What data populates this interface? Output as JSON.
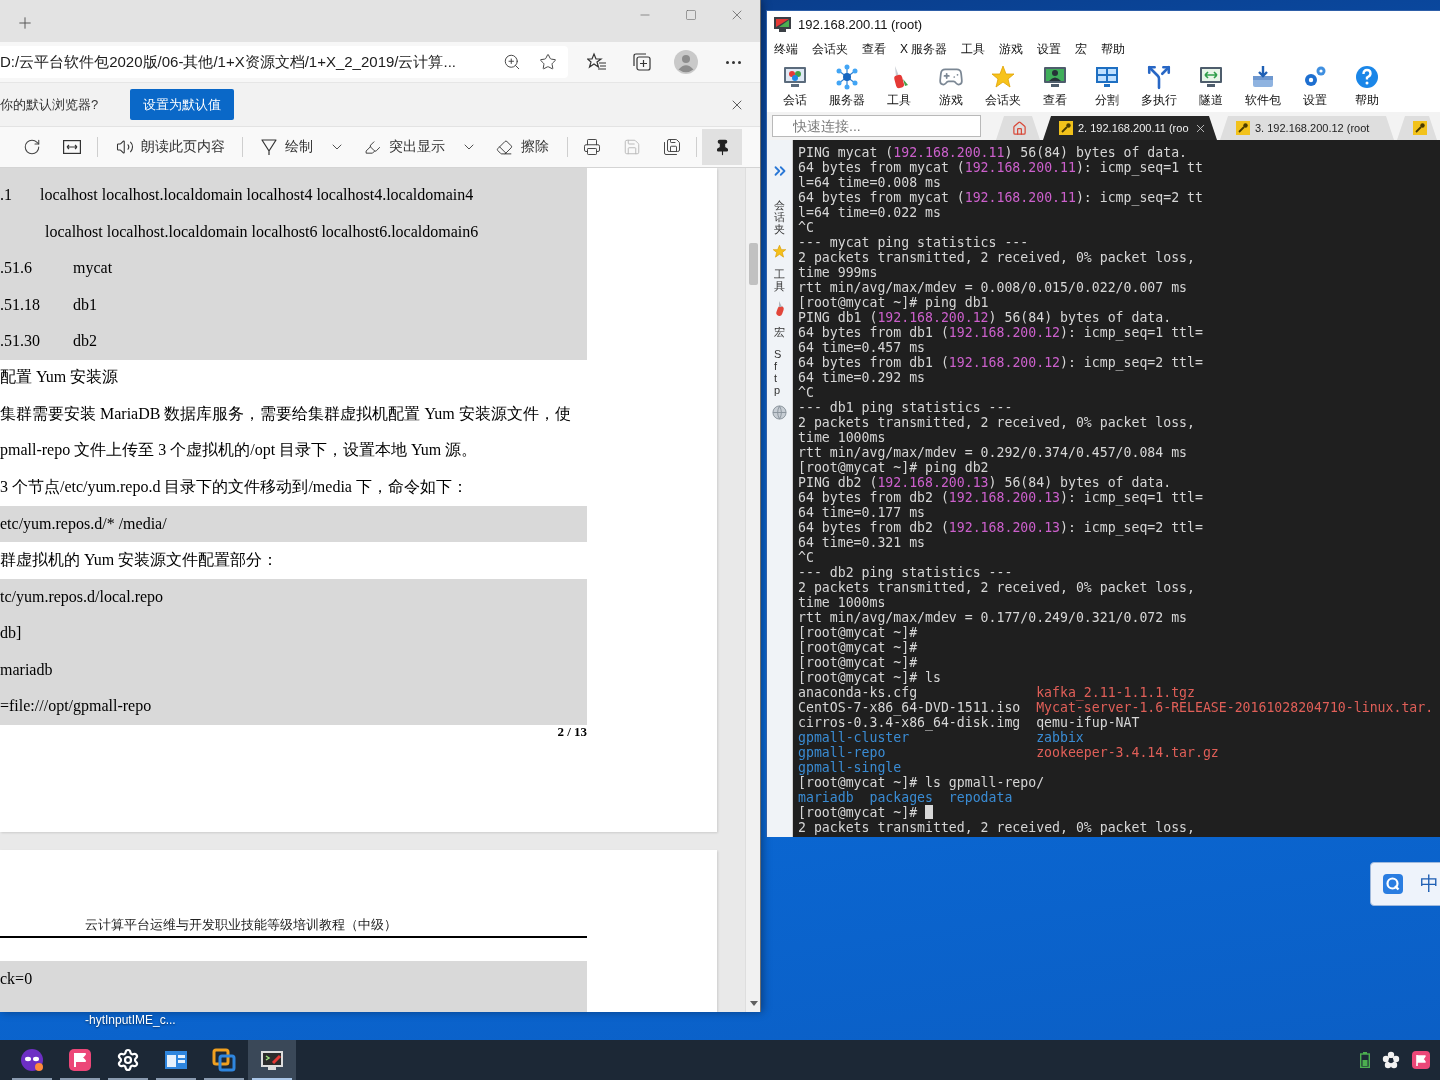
{
  "browser": {
    "address": "D:/云平台软件包2020版/06-其他/1+X资源文档/1+X_2_2019/云计算...",
    "infobar": {
      "message": "你的默认浏览器?",
      "button": "设置为默认值"
    },
    "pdf_toolbar": {
      "read_aloud": "朗读此页内容",
      "draw": "绘制",
      "highlight": "突出显示",
      "erase": "擦除",
      "save": {
        "disabled": true
      },
      "pin": {
        "on": true
      }
    },
    "pages": [
      {
        "blocks": [
          {
            "kind": "code",
            "lines": [
              {
                "address": ".1",
                "text": "localhost localhost.localdomain localhost4 localhost4.localdomain4"
              },
              {
                "text": "localhost localhost.localdomain localhost6 localhost6.localdomain6"
              },
              {
                "address": ".51.6",
                "text": "mycat"
              },
              {
                "address": ".51.18",
                "text": "db1"
              },
              {
                "address": ".51.30",
                "text": "db2"
              }
            ]
          },
          {
            "kind": "text",
            "text": "配置 Yum 安装源"
          },
          {
            "kind": "text",
            "text": "集群需要安装 MariaDB 数据库服务，需要给集群虚拟机配置 Yum 安装源文件，使"
          },
          {
            "kind": "text",
            "text": "pmall-repo 文件上传至 3 个虚拟机的/opt 目录下，设置本地 Yum 源。"
          },
          {
            "kind": "text",
            "text": "3 个节点/etc/yum.repo.d 目录下的文件移动到/media 下，命令如下："
          },
          {
            "kind": "code",
            "lines": [
              {
                "text": "etc/yum.repos.d/* /media/"
              }
            ]
          },
          {
            "kind": "text",
            "text": "群虚拟机的 Yum 安装源文件配置部分："
          },
          {
            "kind": "code",
            "lines": [
              {
                "text": "tc/yum.repos.d/local.repo"
              },
              {
                "text": "db]"
              },
              {
                "text": "mariadb"
              },
              {
                "text": "=file:///opt/gpmall-repo"
              }
            ]
          },
          {
            "kind": "page_number",
            "text": "2 / 13"
          }
        ]
      },
      {
        "blocks": [
          {
            "kind": "header",
            "text": "云计算平台运维与开发职业技能等级培训教程（中级）"
          },
          {
            "kind": "code",
            "lines": [
              {
                "text": "ck=0"
              }
            ]
          }
        ]
      }
    ]
  },
  "terminal": {
    "title": "192.168.200.11 (root)",
    "menu": [
      "终端",
      "会话夹",
      "查看",
      "X 服务器",
      "工具",
      "游戏",
      "设置",
      "宏",
      "帮助"
    ],
    "toolbar": [
      "会话",
      "服务器",
      "工具",
      "游戏",
      "会话夹",
      "查看",
      "分割",
      "多执行",
      "隧道",
      "软件包",
      "设置",
      "帮助"
    ],
    "quick_connect": {
      "placeholder": "快速连接..."
    },
    "tabs": [
      {
        "kind": "home",
        "selected": false
      },
      {
        "kind": "session",
        "label": "2. 192.168.200.11 (roo",
        "selected": true
      },
      {
        "kind": "session",
        "label": "3. 192.168.200.12 (root",
        "selected": false
      },
      {
        "kind": "session",
        "selected": false
      }
    ],
    "sidebar": {
      "tabs": [
        {
          "label": "会话夹"
        },
        {
          "label": "工具"
        },
        {
          "label": "宏"
        },
        {
          "label": "Sftp"
        }
      ]
    },
    "lines": [
      {
        "segments": [
          {
            "text": "PING mycat ("
          },
          {
            "text": "192.168.200.11",
            "kind": "ip"
          },
          {
            "text": ") 56(84) bytes of data."
          }
        ]
      },
      {
        "segments": [
          {
            "text": "64 bytes from mycat ("
          },
          {
            "text": "192.168.200.11",
            "kind": "ip"
          },
          {
            "text": "): icmp_seq=1 tt"
          }
        ]
      },
      {
        "text": "l=64 time=0.008 ms"
      },
      {
        "segments": [
          {
            "text": "64 bytes from mycat ("
          },
          {
            "text": "192.168.200.11",
            "kind": "ip"
          },
          {
            "text": "): icmp_seq=2 tt"
          }
        ]
      },
      {
        "text": "l=64 time=0.022 ms"
      },
      {
        "text": "^C"
      },
      {
        "text": "--- mycat ping statistics ---"
      },
      {
        "text": "2 packets transmitted, 2 received, 0% packet loss,"
      },
      {
        "text": "time 999ms"
      },
      {
        "text": "rtt min/avg/max/mdev = 0.008/0.015/0.022/0.007 ms"
      },
      {
        "text": "[root@mycat ~]# ping db1"
      },
      {
        "segments": [
          {
            "text": "PING db1 ("
          },
          {
            "text": "192.168.200.12",
            "kind": "ip"
          },
          {
            "text": ") 56(84) bytes of data."
          }
        ]
      },
      {
        "segments": [
          {
            "text": "64 bytes from db1 ("
          },
          {
            "text": "192.168.200.12",
            "kind": "ip"
          },
          {
            "text": "): icmp_seq=1 ttl="
          }
        ]
      },
      {
        "text": "64 time=0.457 ms"
      },
      {
        "segments": [
          {
            "text": "64 bytes from db1 ("
          },
          {
            "text": "192.168.200.12",
            "kind": "ip"
          },
          {
            "text": "): icmp_seq=2 ttl="
          }
        ]
      },
      {
        "text": "64 time=0.292 ms"
      },
      {
        "text": "^C"
      },
      {
        "text": "--- db1 ping statistics ---"
      },
      {
        "text": "2 packets transmitted, 2 received, 0% packet loss,"
      },
      {
        "text": "time 1000ms"
      },
      {
        "text": "rtt min/avg/max/mdev = 0.292/0.374/0.457/0.084 ms"
      },
      {
        "text": "[root@mycat ~]# ping db2"
      },
      {
        "segments": [
          {
            "text": "PING db2 ("
          },
          {
            "text": "192.168.200.13",
            "kind": "ip"
          },
          {
            "text": ") 56(84) bytes of data."
          }
        ]
      },
      {
        "segments": [
          {
            "text": "64 bytes from db2 ("
          },
          {
            "text": "192.168.200.13",
            "kind": "ip"
          },
          {
            "text": "): icmp_seq=1 ttl="
          }
        ]
      },
      {
        "text": "64 time=0.177 ms"
      },
      {
        "segments": [
          {
            "text": "64 bytes from db2 ("
          },
          {
            "text": "192.168.200.13",
            "kind": "ip"
          },
          {
            "text": "): icmp_seq=2 ttl="
          }
        ]
      },
      {
        "text": "64 time=0.321 ms"
      },
      {
        "text": "^C"
      },
      {
        "text": "--- db2 ping statistics ---"
      },
      {
        "text": "2 packets transmitted, 2 received, 0% packet loss,"
      },
      {
        "text": "time 1000ms"
      },
      {
        "text": "rtt min/avg/max/mdev = 0.177/0.249/0.321/0.072 ms"
      },
      {
        "text": "[root@mycat ~]#"
      },
      {
        "text": "[root@mycat ~]#"
      },
      {
        "text": "[root@mycat ~]#"
      },
      {
        "text": "[root@mycat ~]# ls"
      },
      {
        "kind": "listing",
        "columns": [
          {
            "text": "anaconda-ks.cfg"
          },
          {
            "text": "kafka_2.11-1.1.1.tgz",
            "kind": "archive"
          }
        ]
      },
      {
        "kind": "listing",
        "columns": [
          {
            "text": "CentOS-7-x86_64-DVD-1511.iso"
          },
          {
            "text": "Mycat-server-1.6-RELEASE-20161028204710-linux.tar.",
            "kind": "archive"
          }
        ]
      },
      {
        "kind": "listing",
        "columns": [
          {
            "text": "cirros-0.3.4-x86_64-disk.img"
          },
          {
            "text": "qemu-ifup-NAT"
          }
        ]
      },
      {
        "kind": "listing",
        "columns": [
          {
            "text": "gpmall-cluster",
            "kind": "dir"
          },
          {
            "text": "zabbix",
            "kind": "dir"
          }
        ]
      },
      {
        "kind": "listing",
        "columns": [
          {
            "text": "gpmall-repo",
            "kind": "dir"
          },
          {
            "text": "zookeeper-3.4.14.tar.gz",
            "kind": "archive"
          }
        ]
      },
      {
        "kind": "listing",
        "columns": [
          {
            "text": "gpmall-single",
            "kind": "dir"
          }
        ]
      },
      {
        "text": "[root@mycat ~]# ls gpmall-repo/"
      },
      {
        "segments": [
          {
            "text": "mariadb  packages  repodata",
            "kind": "dir"
          }
        ]
      },
      {
        "text": "[root@mycat ~]#",
        "cursor": true
      },
      {
        "text": "2 packets transmitted, 2 received, 0% packet loss,"
      }
    ]
  },
  "desktop_icon_label": "-hytInputIME_c...",
  "ime": {
    "label": "中"
  },
  "taskbar": {
    "apps": [
      {
        "running": true,
        "selected": false
      },
      {
        "running": true,
        "selected": false
      },
      {
        "running": true,
        "selected": false
      },
      {
        "running": true,
        "selected": false
      },
      {
        "running": true,
        "selected": false
      },
      {
        "running": true,
        "selected": true
      }
    ]
  }
}
